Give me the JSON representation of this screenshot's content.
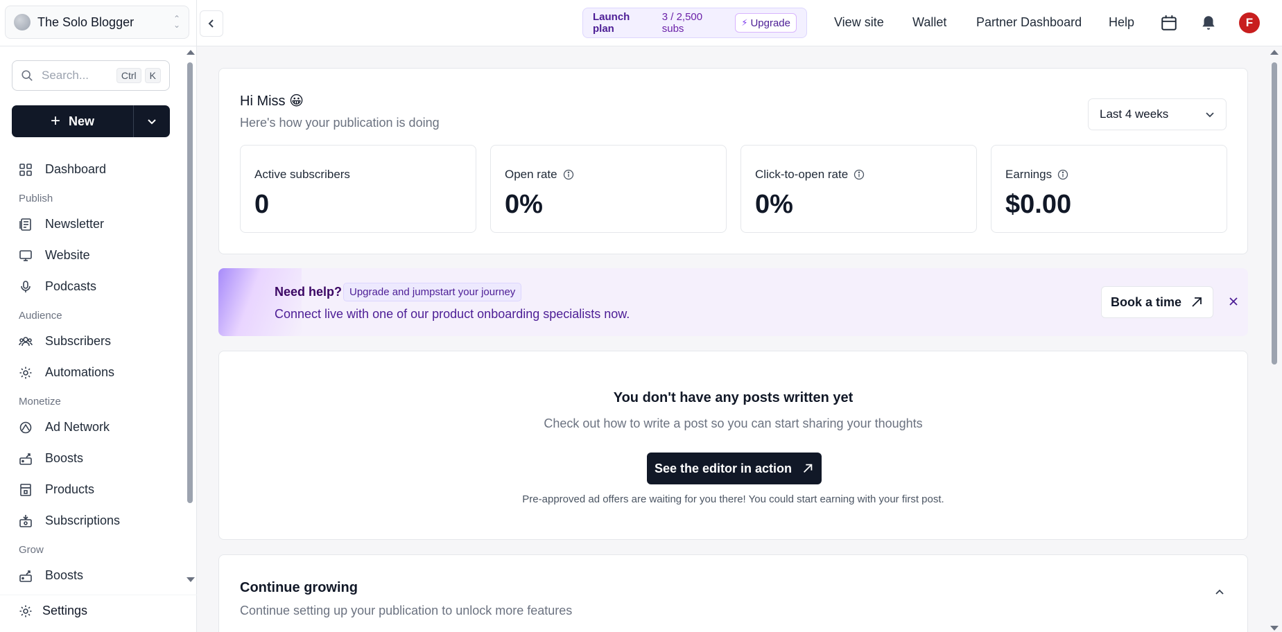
{
  "publication": {
    "name": "The Solo Blogger"
  },
  "search": {
    "placeholder": "Search...",
    "shortcut_ctrl": "Ctrl",
    "shortcut_key": "K"
  },
  "new_button": {
    "label": "New"
  },
  "nav": {
    "dashboard": "Dashboard",
    "publish_section": "Publish",
    "newsletter": "Newsletter",
    "website": "Website",
    "podcasts": "Podcasts",
    "audience_section": "Audience",
    "subscribers": "Subscribers",
    "automations": "Automations",
    "monetize_section": "Monetize",
    "ad_network": "Ad Network",
    "boosts": "Boosts",
    "products": "Products",
    "subscriptions": "Subscriptions",
    "grow_section": "Grow",
    "grow_boosts": "Boosts",
    "settings": "Settings"
  },
  "topbar": {
    "plan_name": "Launch plan",
    "plan_subs": "3 / 2,500 subs",
    "upgrade": "Upgrade",
    "view_site": "View site",
    "wallet": "Wallet",
    "partner_dashboard": "Partner Dashboard",
    "help": "Help",
    "avatar_initial": "F"
  },
  "greeting": {
    "title": "Hi Miss 😀",
    "subtitle": "Here's how your publication is doing",
    "period": "Last 4 weeks"
  },
  "stats": [
    {
      "label": "Active subscribers",
      "value": "0",
      "info": false
    },
    {
      "label": "Open rate",
      "value": "0%",
      "info": true
    },
    {
      "label": "Click-to-open rate",
      "value": "0%",
      "info": true
    },
    {
      "label": "Earnings",
      "value": "$0.00",
      "info": true
    }
  ],
  "help_banner": {
    "title": "Need help?",
    "badge": "Upgrade and jumpstart your journey",
    "subtitle": "Connect live with one of our product onboarding specialists now.",
    "button": "Book a time"
  },
  "posts_empty": {
    "title": "You don't have any posts written yet",
    "subtitle": "Check out how to write a post so you can start sharing your thoughts",
    "button": "See the editor in action",
    "note": "Pre-approved ad offers are waiting for you there! You could start earning with your first post."
  },
  "continue_growing": {
    "title": "Continue growing",
    "subtitle": "Continue setting up your publication to unlock more features"
  },
  "colors": {
    "primary_dark": "#111827",
    "accent_purple": "#7c3aed",
    "avatar_red": "#c81e1e",
    "banner_bg": "#f5f0fc"
  }
}
